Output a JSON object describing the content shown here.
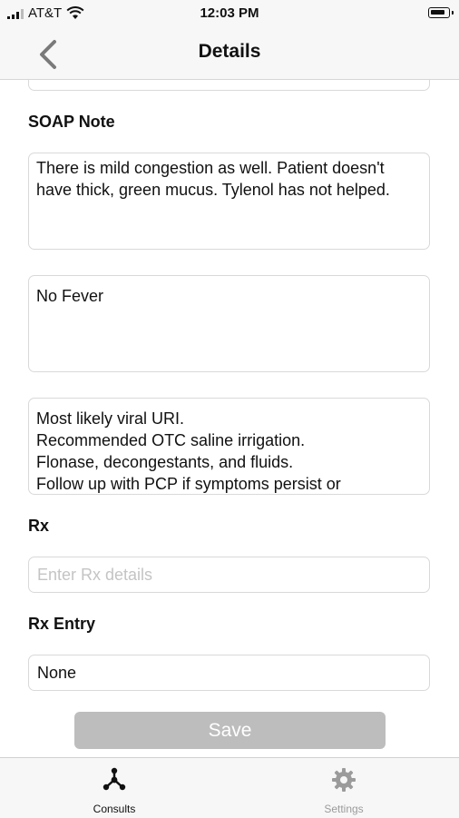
{
  "status": {
    "carrier": "AT&T",
    "time": "12:03 PM"
  },
  "nav": {
    "title": "Details"
  },
  "soap": {
    "label": "SOAP Note",
    "subjective": "There is mild congestion as well. Patient doesn't have thick, green mucus. Tylenol has not helped.",
    "objective": "No Fever",
    "plan": "Most likely viral URI.\nRecommended OTC saline irrigation.\nFlonase, decongestants, and fluids.\nFollow up with PCP if symptoms persist or"
  },
  "rx": {
    "label": "Rx",
    "placeholder": "Enter Rx details"
  },
  "rx_entry": {
    "label": "Rx Entry",
    "value": "None"
  },
  "save_label": "Save",
  "tabs": [
    {
      "label": "Consults",
      "icon": "consults-icon",
      "active": true
    },
    {
      "label": "Settings",
      "icon": "gear-icon",
      "active": false
    }
  ],
  "colors": {
    "active_tab": "#111111",
    "inactive_tab": "#9b9b9b",
    "save_disabled": "#bdbdbd"
  }
}
